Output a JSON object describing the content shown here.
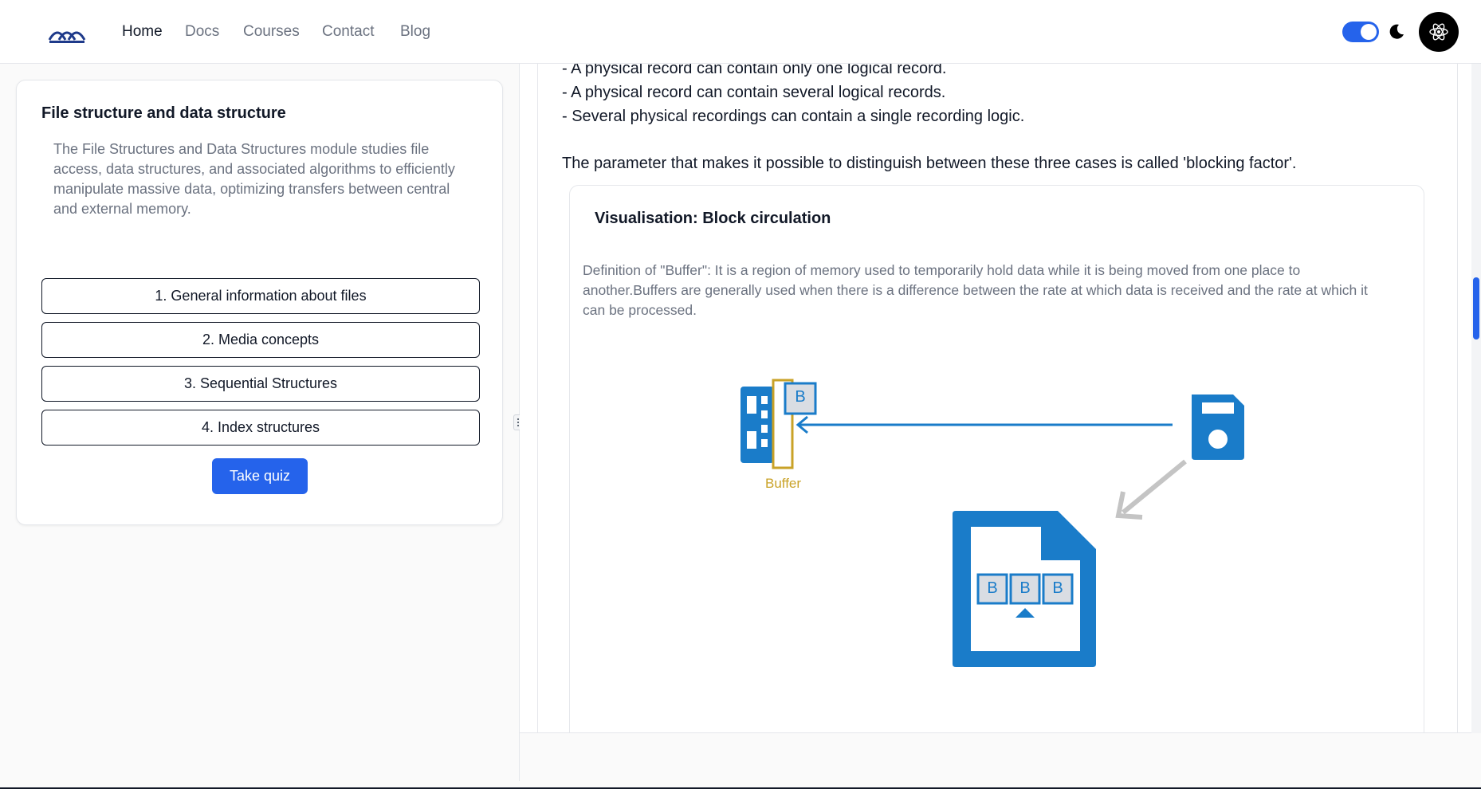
{
  "nav": {
    "logo": "site-logo",
    "links": [
      "Home",
      "Docs",
      "Courses",
      "Contact",
      "Blog"
    ],
    "active": "Home",
    "theme_toggle_on": true
  },
  "sidebar": {
    "title": "File structure and data structure",
    "description": "The File Structures and Data Structures module studies file access, data structures, and associated algorithms to efficiently manipulate massive data, optimizing transfers between central and external memory.",
    "chapters": [
      "1. General information about files",
      "2. Media concepts",
      "3. Sequential Structures",
      "4. Index structures"
    ],
    "quiz_label": "Take quiz"
  },
  "content": {
    "bullets": [
      "- A physical record can contain only one logical record.",
      "- A physical record can contain several logical records.",
      "- Several physical recordings can contain a single recording logic."
    ],
    "paragraph": "The parameter that makes it possible to distinguish between these three cases is called 'blocking factor'.",
    "visualisation": {
      "title": "Visualisation: Block circulation",
      "description": "Definition of \"Buffer\": It is a region of memory used to temporarily hold data while it is being moved from one place to another.Buffers are generally used when there is a difference between the rate at which data is received and the rate at which it can be processed.",
      "buffer_label": "Buffer",
      "block_letter": "B",
      "file_blocks": [
        "B",
        "B",
        "B"
      ]
    }
  },
  "colors": {
    "accent": "#2563eb",
    "diagram_blue": "#1a7cc9",
    "buffer_gold": "#c9a227",
    "arrow_gray": "#c4c4c4"
  }
}
